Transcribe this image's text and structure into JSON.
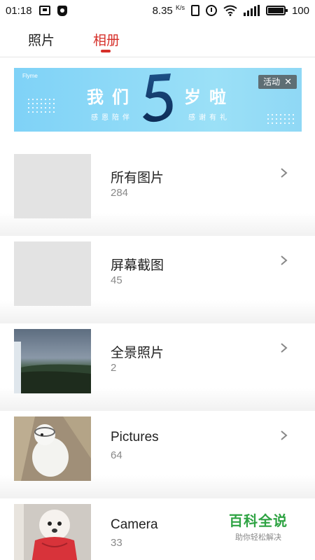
{
  "status_bar": {
    "time": "01:18",
    "speed": "8.35",
    "speed_unit": "K/s",
    "battery": "100",
    "icons": [
      "notification-icon",
      "shield-icon",
      "vibrate-icon",
      "alarm-icon",
      "wifi-icon",
      "signal-icon",
      "battery-icon"
    ]
  },
  "tabs": {
    "photos_label": "照片",
    "albums_label": "相册",
    "active": "相册",
    "accent_color": "#d6302a"
  },
  "banner": {
    "brand": "Flyme",
    "left_title": "我们",
    "left_subtitle": "感恩陪伴",
    "number": "5",
    "right_title": "岁啦",
    "right_subtitle": "感谢有礼",
    "badge_label": "活动"
  },
  "albums": [
    {
      "name": "所有图片",
      "count": "284",
      "thumb": "blank"
    },
    {
      "name": "屏幕截图",
      "count": "45",
      "thumb": "blank"
    },
    {
      "name": "全景照片",
      "count": "2",
      "thumb": "panorama"
    },
    {
      "name": "Pictures",
      "count": "64",
      "thumb": "dog-white"
    },
    {
      "name": "Camera",
      "count": "33",
      "thumb": "dog-red"
    }
  ],
  "watermark": {
    "main": "百科全说",
    "sub": "助你轻松解决"
  }
}
